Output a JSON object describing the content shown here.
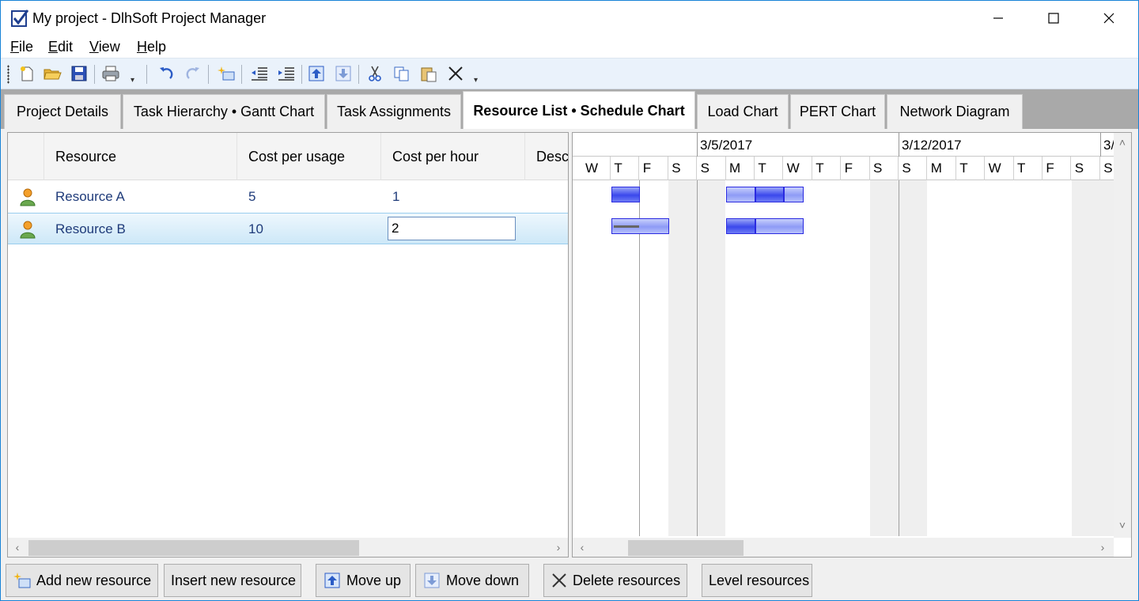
{
  "window": {
    "title": "My project - DlhSoft Project Manager"
  },
  "menu": {
    "items": [
      {
        "label": "File",
        "accel": "F",
        "rest": "ile"
      },
      {
        "label": "Edit",
        "accel": "E",
        "rest": "dit"
      },
      {
        "label": "View",
        "accel": "V",
        "rest": "iew"
      },
      {
        "label": "Help",
        "accel": "H",
        "rest": "elp"
      }
    ]
  },
  "toolbar": {
    "buttons": [
      "new-icon",
      "open-icon",
      "save-icon",
      "print-icon",
      "undo-icon",
      "redo-icon",
      "insert-icon",
      "outdent-icon",
      "indent-icon",
      "move-up-icon",
      "move-down-icon",
      "cut-icon",
      "copy-icon",
      "paste-icon",
      "delete-icon"
    ]
  },
  "tabs": [
    {
      "label": "Project Details",
      "active": false
    },
    {
      "label": "Task Hierarchy • Gantt Chart",
      "active": false
    },
    {
      "label": "Task Assignments",
      "active": false
    },
    {
      "label": "Resource List • Schedule Chart",
      "active": true
    },
    {
      "label": "Load Chart",
      "active": false
    },
    {
      "label": "PERT Chart",
      "active": false
    },
    {
      "label": "Network Diagram",
      "active": false
    }
  ],
  "grid": {
    "columns": [
      "Resource",
      "Cost per usage",
      "Cost per hour",
      "Descr"
    ],
    "rows": [
      {
        "resource": "Resource A",
        "cost_per_usage": "5",
        "cost_per_hour": "1",
        "selected": false
      },
      {
        "resource": "Resource B",
        "cost_per_usage": "10",
        "cost_per_hour": "2",
        "selected": true
      }
    ]
  },
  "chart": {
    "weeks": [
      "3/5/2017",
      "3/12/2017",
      "3/"
    ],
    "days": [
      "W",
      "T",
      "F",
      "S",
      "S",
      "M",
      "T",
      "W",
      "T",
      "F",
      "S",
      "S",
      "M",
      "T",
      "W",
      "T",
      "F",
      "S",
      "S"
    ]
  },
  "footer": {
    "add_new": "Add new resource",
    "insert_new": "Insert new resource",
    "move_up": "Move up",
    "move_down": "Move down",
    "delete": "Delete resources",
    "level": "Level resources"
  },
  "colors": {
    "accent": "#1883d7",
    "bar": "#3a48ec",
    "selection": "#cde8f8"
  }
}
